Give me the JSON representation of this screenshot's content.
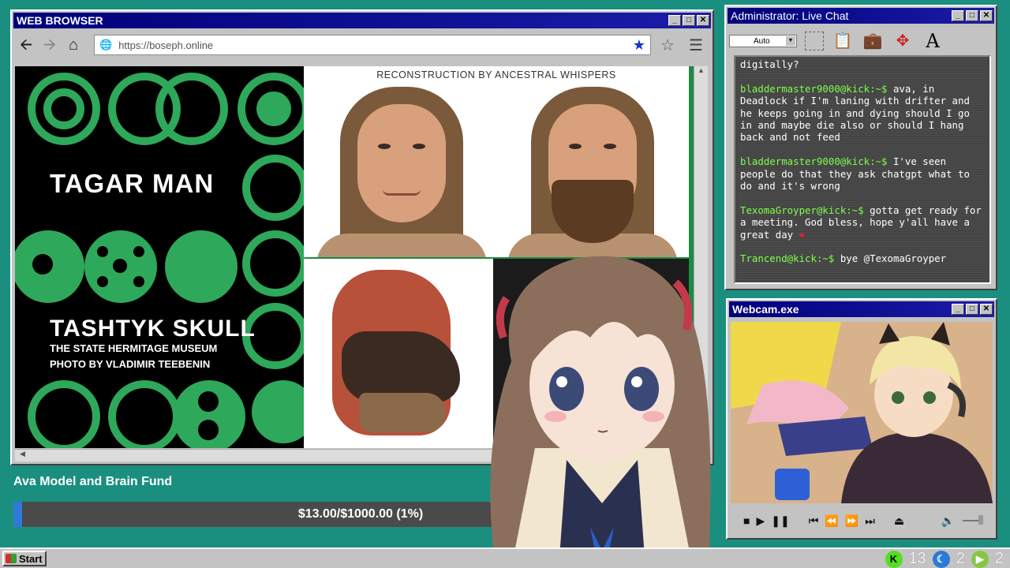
{
  "browser": {
    "title": "WEB BROWSER",
    "url": "https://boseph.online",
    "icons": {
      "back": "back-arrow-icon",
      "forward": "forward-arrow-icon",
      "home": "home-icon",
      "globe": "globe-icon",
      "bookmarked": "star-filled-icon",
      "bookmark": "star-outline-icon",
      "menu": "hamburger-menu-icon"
    }
  },
  "slide": {
    "title1": "TAGAR MAN",
    "title2": "TASHTYK SKULL",
    "credit1": "THE STATE HERMITAGE MUSEUM",
    "credit2": "PHOTO BY VLADIMIR TEEBENIN",
    "recon_caption": "RECONSTRUCTION BY ANCESTRAL WHISPERS",
    "colors": {
      "green": "#2ea85a",
      "black": "#000000"
    }
  },
  "fund": {
    "title": "Ava Model and Brain Fund",
    "progress_text": "$13.00/$1000.00 (1%)",
    "progress_fraction": 0.013,
    "fill_color": "#2f7ad8"
  },
  "chat": {
    "title": "Administrator: Live Chat",
    "font_size_value": "Auto",
    "messages": [
      {
        "user": "",
        "text": "digitally?"
      },
      {
        "user": "bladdermaster9000@kick:~$",
        "text": " ava, in Deadlock if I'm laning with drifter and he keeps going in and dying should I go in and maybe die also or should I hang back and not feed"
      },
      {
        "user": "bladdermaster9000@kick:~$",
        "text": " I've seen people do that they ask chatgpt what to do and it's wrong"
      },
      {
        "user": "TexomaGroyper@kick:~$",
        "text": " gotta get ready for a meeting. God bless, hope y'all have a great day"
      },
      {
        "user": "Trancend@kick:~$",
        "text": " bye @TexomaGroyper"
      }
    ],
    "user_color": "#7dff4a"
  },
  "webcam": {
    "title": "Webcam.exe",
    "controls": [
      "stop",
      "play",
      "pause",
      "skip-back",
      "rewind",
      "fast-forward",
      "skip-forward",
      "eject"
    ]
  },
  "taskbar": {
    "start_label": "Start",
    "tray": [
      {
        "icon": "kick-icon",
        "count": "13"
      },
      {
        "icon": "moon-icon",
        "count": "2"
      },
      {
        "icon": "rumble-icon",
        "count": "2"
      }
    ]
  },
  "window_buttons": {
    "minimize": "_",
    "maximize": "□",
    "close": "✕"
  }
}
